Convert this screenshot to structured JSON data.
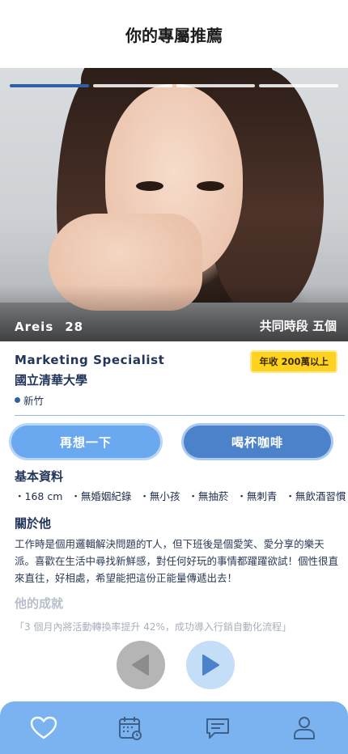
{
  "header": {
    "title": "你的專屬推薦"
  },
  "profile": {
    "name": "Areis",
    "age": "28",
    "shared_time": "共同時段 五個",
    "job": "Marketing Specialist",
    "school": "國立清華大學",
    "location": "新竹",
    "income_badge": "年收 200萬以上",
    "photo_count": 4,
    "active_photo_index": 0
  },
  "actions": {
    "reconsider_label": "再想一下",
    "coffee_label": "喝杯咖啡"
  },
  "basic_info": {
    "title": "基本資料",
    "tags": [
      "・168 cm",
      "・無婚姻紀錄",
      "・無小孩",
      "・無抽菸",
      "・無刺青",
      "・無飲酒習慣"
    ]
  },
  "about": {
    "title": "關於他",
    "text": "工作時是個用邏輯解決問題的T人，但下班後是個愛笑、愛分享的樂天派。喜歡在生活中尋找新鮮感，對任何好玩的事情都躍躍欲試！個性很直來直往，好相處，希望能把這份正能量傳遞出去！"
  },
  "achievements": {
    "title": "他的成就",
    "text": "「3 個月內將活動轉換率提升 42%，成功導入行銷自動化流程」"
  },
  "nav_icons": [
    "heart-icon",
    "calendar-icon",
    "chat-icon",
    "user-icon"
  ],
  "colors": {
    "accent": "#4b82c9",
    "light_accent": "#6aa9ef",
    "tabbar": "#7ab3f0",
    "badge": "#ffd21f",
    "progress_active": "#2f5fa8"
  }
}
